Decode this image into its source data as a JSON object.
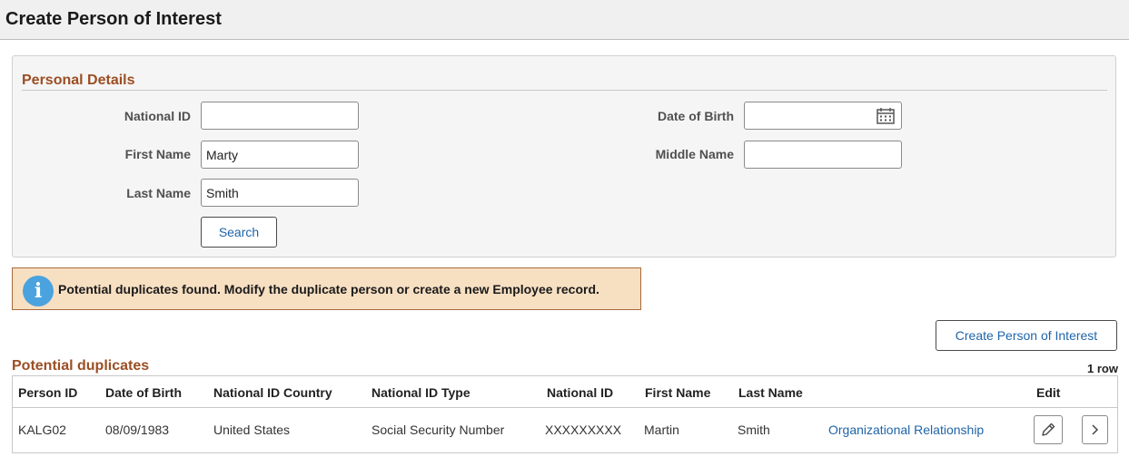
{
  "page": {
    "title": "Create Person of Interest"
  },
  "personal_details": {
    "title": "Personal Details",
    "national_id": {
      "label": "National ID",
      "value": ""
    },
    "first_name": {
      "label": "First Name",
      "value": "Marty"
    },
    "last_name": {
      "label": "Last Name",
      "value": "Smith"
    },
    "date_of_birth": {
      "label": "Date of Birth",
      "value": ""
    },
    "middle_name": {
      "label": "Middle Name",
      "value": ""
    },
    "search_label": "Search"
  },
  "message": {
    "icon": "info-icon",
    "text": "Potential duplicates found. Modify the duplicate person or create a new Employee record."
  },
  "create_button_label": "Create Person of Interest",
  "duplicates": {
    "title": "Potential duplicates",
    "row_count": "1 row",
    "columns": [
      "Person ID",
      "Date of Birth",
      "National ID Country",
      "National ID Type",
      "National ID",
      "First Name",
      "Last Name",
      "",
      "Edit"
    ],
    "rows": [
      {
        "person_id": "KALG02",
        "date_of_birth": "08/09/1983",
        "national_id_country": "United States",
        "national_id_type": "Social Security Number",
        "national_id": "XXXXXXXXX",
        "first_name": "Martin",
        "last_name": "Smith",
        "org_relationship": "Organizational Relationship"
      }
    ]
  },
  "colors": {
    "section_title": "#9b4e23",
    "link": "#1f64a8",
    "message_bg": "#f7dfc2",
    "info_icon": "#4aa3df"
  }
}
